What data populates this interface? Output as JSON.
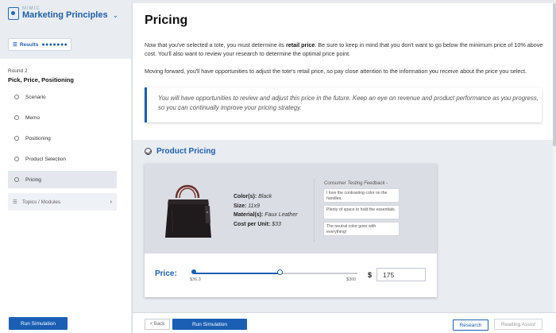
{
  "app": {
    "brand_small": "MIMIC",
    "brand_title": "Marketing Principles",
    "results_label": "Results",
    "results_dots": "●●●●●●●"
  },
  "sidebar": {
    "round": "Round 2",
    "round_title": "Pick, Price, Positioning",
    "items": [
      {
        "label": "Scenario",
        "active": false
      },
      {
        "label": "Memo",
        "active": false
      },
      {
        "label": "Positioning",
        "active": false
      },
      {
        "label": "Product Selection",
        "active": false
      },
      {
        "label": "Pricing",
        "active": true
      }
    ],
    "topics_label": "Topics / Modules",
    "run_simulation": "Run Simulation"
  },
  "main": {
    "title": "Pricing",
    "para1_a": "Now that you've selected a tote, you must determine its ",
    "para1_bold": "retail price",
    "para1_b": ". Be sure to keep in mind that you don't want to go below the minimum price of 10% above cost. You'll also want to review your research to determine the optimal price point.",
    "para2": "Moving forward, you'll have opportunities to adjust the tote's retail price, so pay close attention to the information you receive about the price you select.",
    "callout": "You will have opportunities to review and adjust this price in the future. Keep an eye on revenue and product performance as you progress, so you can continually improve your pricing strategy.",
    "section_title": "Product Pricing",
    "product": {
      "color_label": "Color(s):",
      "color_value": "Black",
      "size_label": "Size:",
      "size_value": "11x9",
      "material_label": "Material(s):",
      "material_value": "Faux Leather",
      "cost_label": "Cost per Unit:",
      "cost_value": "$33"
    },
    "feedback_title": "Consumer Testing Feedback -",
    "feedback": [
      "I love the contrasting color on the handles.",
      "Plenty of space to hold the essentials.",
      "The neutral color goes with everything!"
    ],
    "price_label": "Price:",
    "slider": {
      "min_label": "$36.3",
      "max_label": "$300",
      "min": 36.3,
      "max": 300,
      "value": 175
    },
    "currency_symbol": "$",
    "price_value": "175"
  },
  "footer": {
    "back": "< Back",
    "run_simulation": "Run Simulation",
    "research": "Research",
    "reading_assist": "Reading Assist"
  },
  "colors": {
    "accent": "#1a5fb4",
    "title_blue": "#1e5fa8"
  }
}
